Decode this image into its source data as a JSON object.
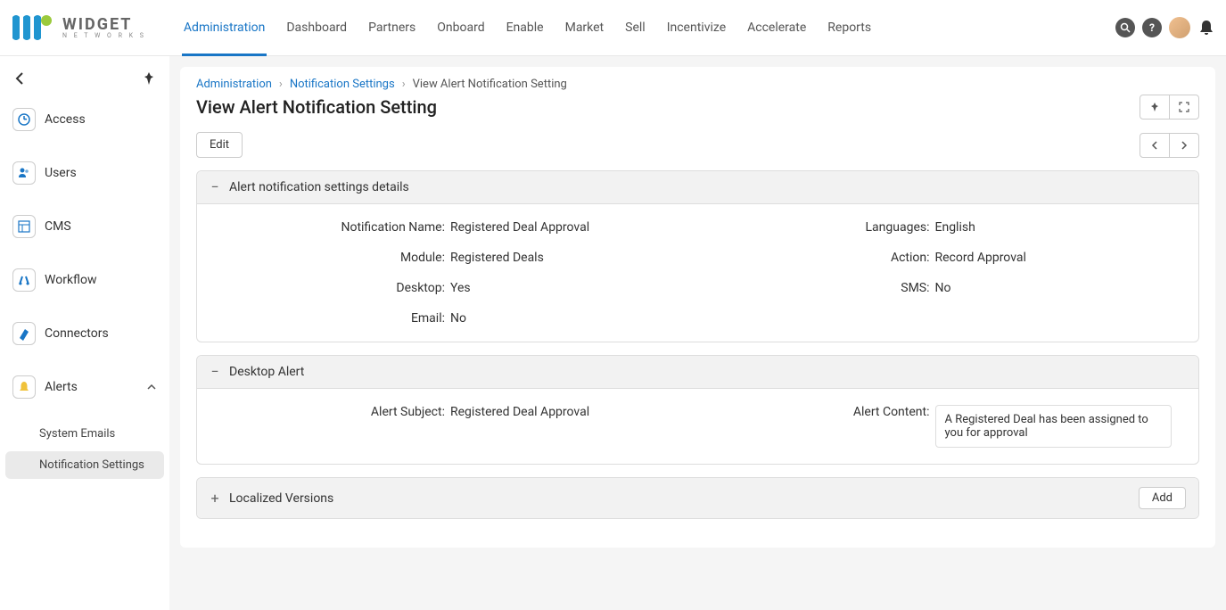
{
  "brand": {
    "word": "WIDGET",
    "sub": "N E T W O R K S"
  },
  "topnav": [
    "Administration",
    "Dashboard",
    "Partners",
    "Onboard",
    "Enable",
    "Market",
    "Sell",
    "Incentivize",
    "Accelerate",
    "Reports"
  ],
  "crumbs": {
    "a": "Administration",
    "b": "Notification Settings",
    "c": "View Alert Notification Setting"
  },
  "page_title": "View Alert Notification Setting",
  "edit": "Edit",
  "add": "Add",
  "sidebar": {
    "items": [
      {
        "label": "Access"
      },
      {
        "label": "Users"
      },
      {
        "label": "CMS"
      },
      {
        "label": "Workflow"
      },
      {
        "label": "Connectors"
      },
      {
        "label": "Alerts"
      }
    ],
    "subs": [
      "System Emails",
      "Notification Settings"
    ]
  },
  "p1": {
    "title": "Alert notification settings details",
    "f": {
      "notif_name_l": "Notification Name:",
      "notif_name_v": "Registered Deal Approval",
      "lang_l": "Languages:",
      "lang_v": "English",
      "module_l": "Module:",
      "module_v": "Registered Deals",
      "action_l": "Action:",
      "action_v": "Record Approval",
      "desktop_l": "Desktop:",
      "desktop_v": "Yes",
      "sms_l": "SMS:",
      "sms_v": "No",
      "email_l": "Email:",
      "email_v": "No"
    }
  },
  "p2": {
    "title": "Desktop Alert",
    "f": {
      "subj_l": "Alert Subject:",
      "subj_v": "Registered Deal Approval",
      "content_l": "Alert Content:",
      "content_v": "A Registered Deal has been assigned to you for approval"
    }
  },
  "p3": {
    "title": "Localized Versions"
  }
}
